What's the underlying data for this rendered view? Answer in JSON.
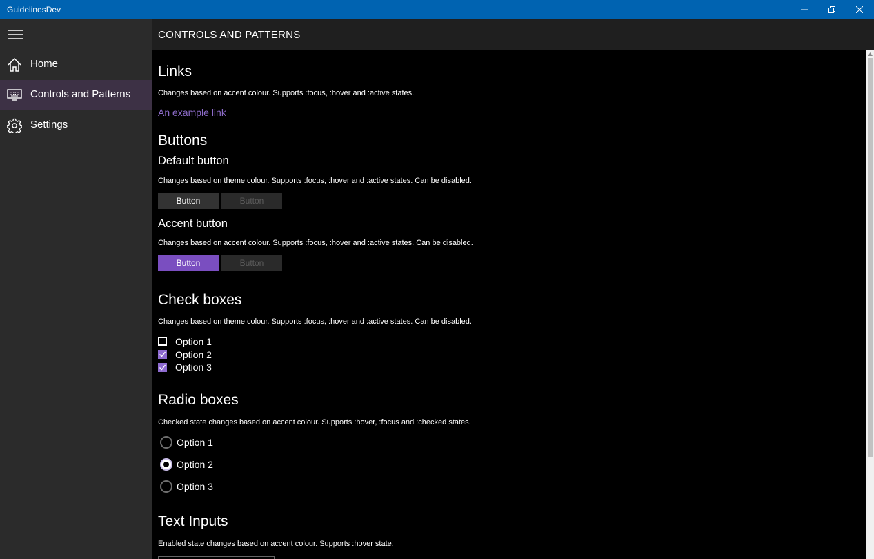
{
  "window": {
    "title": "GuidelinesDev"
  },
  "sidebar": {
    "items": [
      {
        "label": "Home",
        "icon": "home-icon"
      },
      {
        "label": "Controls and Patterns",
        "icon": "monitor-keyboard-icon",
        "selected": true
      },
      {
        "label": "Settings",
        "icon": "gear-icon"
      }
    ]
  },
  "header": {
    "title": "CONTROLS AND PATTERNS"
  },
  "colors": {
    "accent": "#7a4ec0",
    "titlebar": "#0063b1",
    "link": "#8c6bc8"
  },
  "links": {
    "heading": "Links",
    "description": "Changes based on accent colour. Supports :focus, :hover and :active states.",
    "example": "An example link"
  },
  "buttons": {
    "heading": "Buttons",
    "default": {
      "heading": "Default button",
      "description": "Changes based on theme colour. Supports :focus, :hover and :active states. Can be disabled.",
      "enabled_label": "Button",
      "disabled_label": "Button"
    },
    "accent": {
      "heading": "Accent button",
      "description": "Changes based on accent colour. Supports :focus, :hover and :active states. Can be disabled.",
      "enabled_label": "Button",
      "disabled_label": "Button"
    }
  },
  "checkboxes": {
    "heading": "Check boxes",
    "description": "Changes based on theme colour. Supports :focus, :hover and :active states. Can be disabled.",
    "options": [
      {
        "label": "Option 1",
        "checked": false
      },
      {
        "label": "Option 2",
        "checked": true
      },
      {
        "label": "Option 3",
        "checked": true
      }
    ]
  },
  "radios": {
    "heading": "Radio boxes",
    "description": "Checked state changes based on accent colour. Supports :hover, :focus and :checked states.",
    "options": [
      {
        "label": "Option 1",
        "checked": false
      },
      {
        "label": "Option 2",
        "checked": true
      },
      {
        "label": "Option 3",
        "checked": false
      }
    ]
  },
  "textinputs": {
    "heading": "Text Inputs",
    "description": "Enabled state changes based on accent colour. Supports :hover state."
  }
}
